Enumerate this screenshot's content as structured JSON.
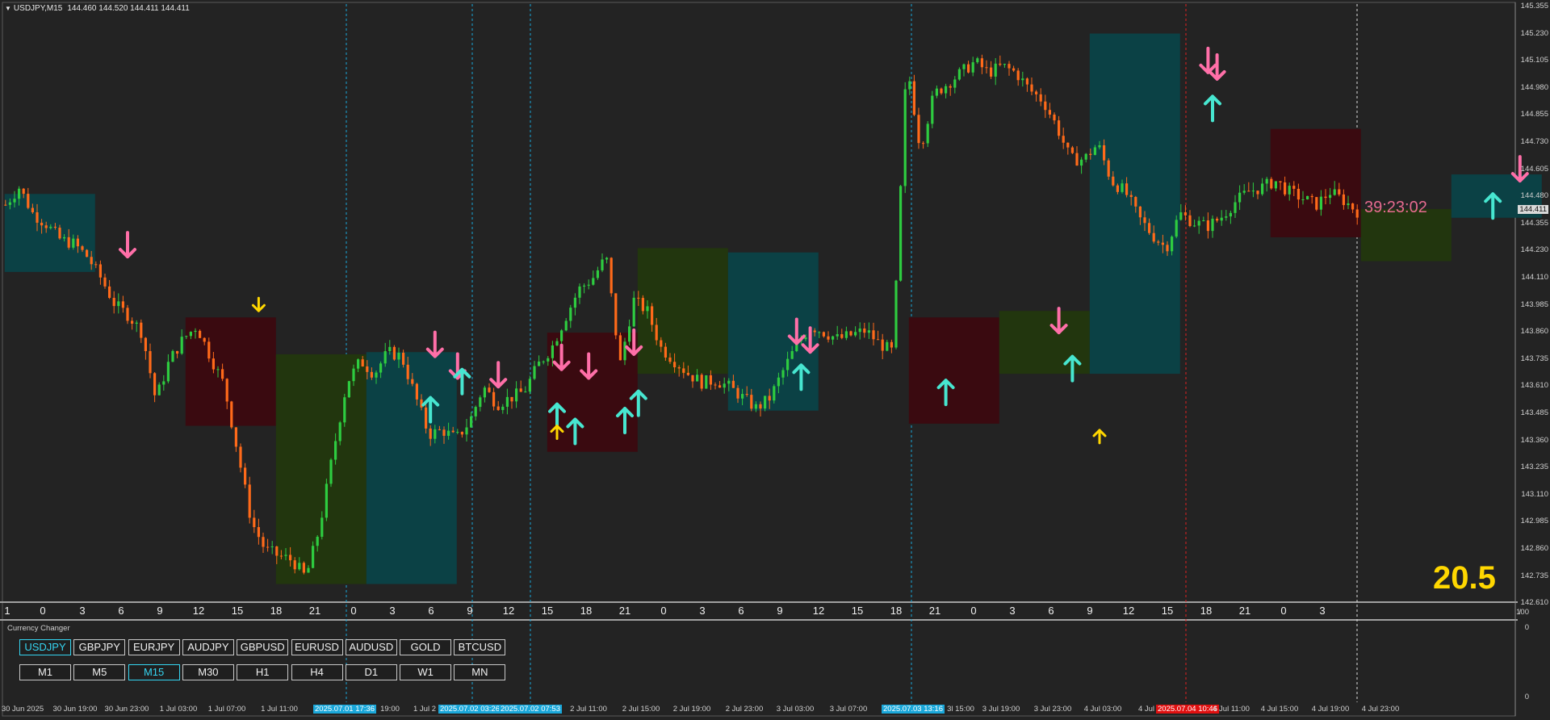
{
  "window": {
    "symbol_timeframe": "USDJPY,M15",
    "ohlc": "144.460 144.520 144.411 144.411",
    "countdown": "39:23:02",
    "spread": "20.5",
    "current_price": "144.411"
  },
  "price_axis": [
    "145.355",
    "145.230",
    "145.105",
    "144.980",
    "144.855",
    "144.730",
    "144.605",
    "144.480",
    "144.355",
    "144.230",
    "144.110",
    "143.985",
    "143.860",
    "143.735",
    "143.610",
    "143.485",
    "143.360",
    "143.235",
    "143.110",
    "142.985",
    "142.860",
    "142.735",
    "142.610"
  ],
  "subwindow_axis": {
    "top": "100",
    "zero_a": "0",
    "zero_b": "0",
    "slash": "/"
  },
  "hour_ticks": [
    "1",
    "0",
    "3",
    "6",
    "9",
    "12",
    "15",
    "18",
    "21",
    "0",
    "3",
    "6",
    "9",
    "12",
    "15",
    "18",
    "21",
    "0",
    "3",
    "6",
    "9",
    "12",
    "15",
    "18",
    "21",
    "0",
    "3",
    "6",
    "9",
    "12",
    "15",
    "18",
    "21",
    "0",
    "3"
  ],
  "currency_changer": {
    "title": "Currency Changer",
    "symbols": [
      "USDJPY",
      "GBPJPY",
      "EURJPY",
      "AUDJPY",
      "GBPUSD",
      "EURUSD",
      "AUDUSD",
      "GOLD",
      "BTCUSD"
    ],
    "active_symbol": "USDJPY",
    "timeframes": [
      "M1",
      "M5",
      "M15",
      "M30",
      "H1",
      "H4",
      "D1",
      "W1",
      "MN"
    ],
    "active_timeframe": "M15"
  },
  "time_axis": [
    "30 Jun 2025",
    "30 Jun 19:00",
    "30 Jun 23:00",
    "1 Jul 03:00",
    "1 Jul 07:00",
    "1 Jul 11:00",
    "2025.07.01 17:36",
    "19:00",
    "1 Jul 2",
    "2025.07.02 03:26",
    "2025.07.02 07:53",
    "2 Jul 11:00",
    "2 Jul 15:00",
    "2 Jul 19:00",
    "2 Jul 23:00",
    "3 Jul 03:00",
    "3 Jul 07:00",
    "2025.07.03 13:16",
    "3l 15:00",
    "3 Jul 19:00",
    "3 Jul 23:00",
    "4 Jul 03:00",
    "4 Jul",
    "2025.07.04 10:46",
    "4 Jul 11:00",
    "4 Jul 15:00",
    "4 Jul 19:00",
    "4 Jul 23:00"
  ],
  "colors": {
    "background": "#232323",
    "bull_candle": "#2ecc40",
    "bear_candle": "#ff6a1a",
    "zone_teal": "#0b4145",
    "zone_maroon": "#3a0a10",
    "zone_olive": "#22360e",
    "arrow_buy": "#47e6d0",
    "arrow_sell": "#ff6fa8",
    "arrow_signal": "#ffd700",
    "session_line": "#1aa7d9",
    "countdown": "#e66b8f",
    "spread": "#ffd700"
  },
  "chart_data": {
    "type": "candlestick",
    "symbol": "USDJPY",
    "timeframe": "M15",
    "ylim": [
      142.61,
      145.355
    ],
    "close_path": [
      [
        0,
        144.44
      ],
      [
        3,
        144.52
      ],
      [
        6,
        144.4
      ],
      [
        9,
        144.35
      ],
      [
        12,
        144.28
      ],
      [
        15,
        144.26
      ],
      [
        18,
        144.2
      ],
      [
        21,
        144.1
      ],
      [
        24,
        143.98
      ],
      [
        27,
        143.93
      ],
      [
        30,
        143.85
      ],
      [
        33,
        143.54
      ],
      [
        36,
        143.72
      ],
      [
        39,
        143.82
      ],
      [
        42,
        143.88
      ],
      [
        45,
        143.74
      ],
      [
        48,
        143.61
      ],
      [
        51,
        143.3
      ],
      [
        54,
        142.98
      ],
      [
        57,
        142.85
      ],
      [
        60,
        142.82
      ],
      [
        63,
        142.8
      ],
      [
        66,
        142.72
      ],
      [
        69,
        142.95
      ],
      [
        72,
        143.3
      ],
      [
        75,
        143.62
      ],
      [
        78,
        143.72
      ],
      [
        81,
        143.66
      ],
      [
        84,
        143.76
      ],
      [
        87,
        143.74
      ],
      [
        90,
        143.56
      ],
      [
        93,
        143.38
      ],
      [
        96,
        143.4
      ],
      [
        99,
        143.36
      ],
      [
        102,
        143.44
      ],
      [
        105,
        143.6
      ],
      [
        108,
        143.52
      ],
      [
        111,
        143.55
      ],
      [
        114,
        143.58
      ],
      [
        117,
        143.7
      ],
      [
        120,
        143.78
      ],
      [
        123,
        143.92
      ],
      [
        126,
        144.05
      ],
      [
        129,
        144.1
      ],
      [
        132,
        144.2
      ],
      [
        135,
        143.7
      ],
      [
        138,
        144.0
      ],
      [
        141,
        143.95
      ],
      [
        144,
        143.78
      ],
      [
        147,
        143.72
      ],
      [
        150,
        143.66
      ],
      [
        153,
        143.62
      ],
      [
        156,
        143.63
      ],
      [
        159,
        143.6
      ],
      [
        162,
        143.55
      ],
      [
        165,
        143.5
      ],
      [
        168,
        143.55
      ],
      [
        171,
        143.68
      ],
      [
        174,
        143.8
      ],
      [
        177,
        143.88
      ],
      [
        180,
        143.85
      ],
      [
        183,
        143.82
      ],
      [
        186,
        143.84
      ],
      [
        189,
        143.86
      ],
      [
        192,
        143.8
      ],
      [
        195,
        143.76
      ],
      [
        198,
        145.1
      ],
      [
        201,
        144.7
      ],
      [
        204,
        144.95
      ],
      [
        207,
        145.0
      ],
      [
        210,
        145.05
      ],
      [
        213,
        145.1
      ],
      [
        216,
        145.05
      ],
      [
        219,
        145.08
      ],
      [
        222,
        145.05
      ],
      [
        225,
        144.97
      ],
      [
        228,
        144.92
      ],
      [
        231,
        144.8
      ],
      [
        234,
        144.65
      ],
      [
        237,
        144.65
      ],
      [
        240,
        144.72
      ],
      [
        243,
        144.55
      ],
      [
        246,
        144.5
      ],
      [
        249,
        144.38
      ],
      [
        252,
        144.3
      ],
      [
        255,
        144.24
      ],
      [
        258,
        144.4
      ],
      [
        261,
        144.36
      ],
      [
        264,
        144.34
      ],
      [
        267,
        144.38
      ],
      [
        270,
        144.45
      ],
      [
        273,
        144.5
      ],
      [
        276,
        144.52
      ],
      [
        279,
        144.55
      ],
      [
        282,
        144.5
      ],
      [
        285,
        144.47
      ],
      [
        288,
        144.44
      ],
      [
        291,
        144.5
      ],
      [
        294,
        144.46
      ],
      [
        297,
        144.41
      ]
    ],
    "candle_count": 300,
    "zones": [
      {
        "i0": 0,
        "i1": 20,
        "y0": 144.49,
        "y1": 144.13,
        "color": "zone_teal"
      },
      {
        "i0": 40,
        "i1": 60,
        "y0": 143.92,
        "y1": 143.42,
        "color": "zone_maroon"
      },
      {
        "i0": 60,
        "i1": 80,
        "y0": 143.75,
        "y1": 142.69,
        "color": "zone_olive"
      },
      {
        "i0": 80,
        "i1": 100,
        "y0": 143.76,
        "y1": 142.69,
        "color": "zone_teal"
      },
      {
        "i0": 120,
        "i1": 140,
        "y0": 143.85,
        "y1": 143.3,
        "color": "zone_maroon"
      },
      {
        "i0": 140,
        "i1": 160,
        "y0": 144.24,
        "y1": 143.66,
        "color": "zone_olive"
      },
      {
        "i0": 160,
        "i1": 180,
        "y0": 144.22,
        "y1": 143.49,
        "color": "zone_teal"
      },
      {
        "i0": 200,
        "i1": 220,
        "y0": 143.92,
        "y1": 143.43,
        "color": "zone_maroon"
      },
      {
        "i0": 220,
        "i1": 240,
        "y0": 143.95,
        "y1": 143.66,
        "color": "zone_olive"
      },
      {
        "i0": 240,
        "i1": 260,
        "y0": 145.23,
        "y1": 143.66,
        "color": "zone_teal"
      },
      {
        "i0": 280,
        "i1": 300,
        "y0": 144.79,
        "y1": 144.29,
        "color": "zone_maroon"
      },
      {
        "i0": 300,
        "i1": 320,
        "y0": 144.42,
        "y1": 144.18,
        "color": "zone_olive"
      },
      {
        "i0": 320,
        "i1": 340,
        "y0": 144.58,
        "y1": 144.38,
        "color": "zone_teal"
      }
    ],
    "signals": [
      {
        "i": 27,
        "p": 144.2,
        "type": "sell"
      },
      {
        "i": 56,
        "p": 143.95,
        "type": "signal_down"
      },
      {
        "i": 95,
        "p": 143.74,
        "type": "sell"
      },
      {
        "i": 100,
        "p": 143.64,
        "type": "sell"
      },
      {
        "i": 109,
        "p": 143.6,
        "type": "sell"
      },
      {
        "i": 94,
        "p": 143.55,
        "type": "buy"
      },
      {
        "i": 101,
        "p": 143.68,
        "type": "buy"
      },
      {
        "i": 123,
        "p": 143.68,
        "type": "sell"
      },
      {
        "i": 129,
        "p": 143.64,
        "type": "sell"
      },
      {
        "i": 139,
        "p": 143.75,
        "type": "sell"
      },
      {
        "i": 122,
        "p": 143.52,
        "type": "buy"
      },
      {
        "i": 126,
        "p": 143.45,
        "type": "buy"
      },
      {
        "i": 137,
        "p": 143.5,
        "type": "buy"
      },
      {
        "i": 140,
        "p": 143.58,
        "type": "buy"
      },
      {
        "i": 122,
        "p": 143.42,
        "type": "signal_up"
      },
      {
        "i": 175,
        "p": 143.8,
        "type": "sell"
      },
      {
        "i": 178,
        "p": 143.76,
        "type": "sell"
      },
      {
        "i": 176,
        "p": 143.7,
        "type": "buy"
      },
      {
        "i": 208,
        "p": 143.63,
        "type": "buy"
      },
      {
        "i": 233,
        "p": 143.85,
        "type": "sell"
      },
      {
        "i": 236,
        "p": 143.74,
        "type": "buy"
      },
      {
        "i": 242,
        "p": 143.4,
        "type": "signal_up"
      },
      {
        "i": 266,
        "p": 145.05,
        "type": "sell"
      },
      {
        "i": 268,
        "p": 145.02,
        "type": "sell"
      },
      {
        "i": 267,
        "p": 144.94,
        "type": "buy"
      },
      {
        "i": 329,
        "p": 144.49,
        "type": "buy"
      },
      {
        "i": 335,
        "p": 144.55,
        "type": "sell"
      }
    ]
  }
}
